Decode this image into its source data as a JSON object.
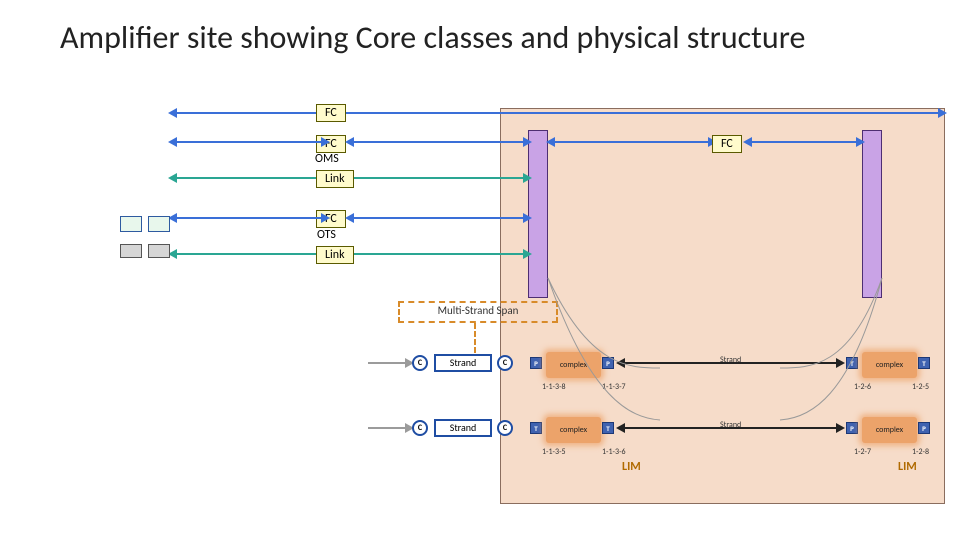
{
  "title": "Amplifier site showing Core classes and physical structure",
  "labels": {
    "fc": "FC",
    "oms": "OMS",
    "link": "Link",
    "ots": "OTS",
    "mss": "Multi-Strand Span",
    "strand": "Strand",
    "complex": "complex",
    "c": "C",
    "p": "P",
    "t": "T",
    "lim": "LIM"
  },
  "ids": {
    "a": "1-1-3-8",
    "b": "1-1-3-7",
    "c": "1-2-6",
    "d": "1-2-5",
    "e": "1-1-3-5",
    "f": "1-1-3-6",
    "g": "1-2-7",
    "h": "1-2-8"
  },
  "colors": {
    "backplane": "#f6dcc9",
    "pill": "#fffbcc",
    "amp": "#c9a3e6",
    "blue": "#3a6fd8",
    "teal": "#2aa693",
    "orange": "#eca36a"
  }
}
